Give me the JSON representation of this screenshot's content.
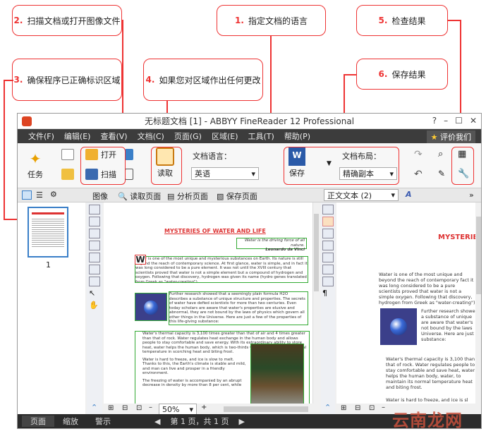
{
  "callouts": [
    {
      "num": "2.",
      "text": "扫描文档或打开图像文件"
    },
    {
      "num": "1.",
      "text": "指定文档的语言"
    },
    {
      "num": "5.",
      "text": "检查结果"
    },
    {
      "num": "3.",
      "text": "确保程序已正确标识区域"
    },
    {
      "num": "4.",
      "text": "如果您对区域作出任何更改"
    },
    {
      "num": "6.",
      "text": "保存结果"
    }
  ],
  "window": {
    "title": "无标题文档 [1] - ABBYY FineReader 12 Professional",
    "menu": [
      "文件(F)",
      "编辑(E)",
      "查看(V)",
      "文档(C)",
      "页面(G)",
      "区域(E)",
      "工具(T)",
      "帮助(P)"
    ],
    "rate_label": "评价我们"
  },
  "toolbar": {
    "task_label": "任务",
    "open_label": "打开",
    "scan_label": "扫描",
    "read_label": "读取",
    "lang_caption": "文档语言：",
    "lang_value": "英语",
    "save_label": "保存",
    "layout_caption": "文档布局：",
    "layout_value": "精确副本"
  },
  "subbar": {
    "image_label": "图像",
    "read_page": "读取页面",
    "analyze_page": "分析页面",
    "save_page": "保存页面",
    "text_mode": "正文文本 (2)"
  },
  "thumbnail": {
    "page_num": "1"
  },
  "document": {
    "heading": "MYSTERIES OF WATER AND LIFE",
    "quote": "Water is the driving force of all nature.",
    "author": "Leonardo da Vinci",
    "p1": "Water is one of the most unique and mysterious substances on Earth. Its nature is still beyond the reach of contemporary science. At first glance, water is simple, and in fact it was long considered to be a pure element. It was not until the XVIII century that scientists proved that water is not a simple element but a compound of hydrogen and oxygen. Following that discovery, hydrogen was given its name (hydro genes translated from Greek as \"water-creating\").",
    "p2": "Further research showed that a seemingly plain formula H2O describes a substance of unique structure and properties. The secrets of water have defied scientists for more than two centuries. Even today scholars are aware that water's properties are elusive and abnormal, they are not bound by the laws of physics which govern all other things in the Universe. Here are just a few of the properties of this life-giving substance:",
    "b1": "Water's thermal capacity is 3,100 times greater than that of air and 4 times greater than that of rock. Water regulates heat exchange in the human body and allows people to stay comfortable and save energy. With its extraordinary ability to store heat, water helps the human body, which is two-thirds water, to maintain its normal temperature in scorching heat and biting frost.",
    "b2": "Water is hard to freeze, and ice is slow to melt. Thanks to this, the Earth's climate is stable and mild, and man can live and prosper in a friendly environment.",
    "b3": "The freezing of water is accompanied by an abrupt decrease in density by more than 8 per cent, while",
    "zoom": "50%",
    "right_heading": "MYSTERIES O",
    "right_p1": "Water is one of the most unique and beyond the reach of contemporary fact it was long considered to be a pure scientists proved that water is not a simple oxygen. Following that discovery, hydrogen from Greek as \"water-creating\").",
    "right_p2": "Further research showed a substance of unique are aware that water's not bound by the laws Universe. Here are just substance:",
    "right_b1": "Water's thermal capacity is 3,100 than that of rock. Water regulates people to stay comfortable and save heat, water helps the human body, water, to maintain its normal temperature heat and biting frost.",
    "right_b2": "Water is hard to freeze, and ice is sl"
  },
  "status": {
    "tab_page": "页面",
    "tab_zoom": "缩放",
    "tab_warn": "警示",
    "page_info": "第 1 页，共 1 页"
  },
  "watermark": "云南龙网",
  "colors": {
    "callout_red": "#e33",
    "menubar": "#3c3c3c",
    "heading_red": "#d33"
  }
}
